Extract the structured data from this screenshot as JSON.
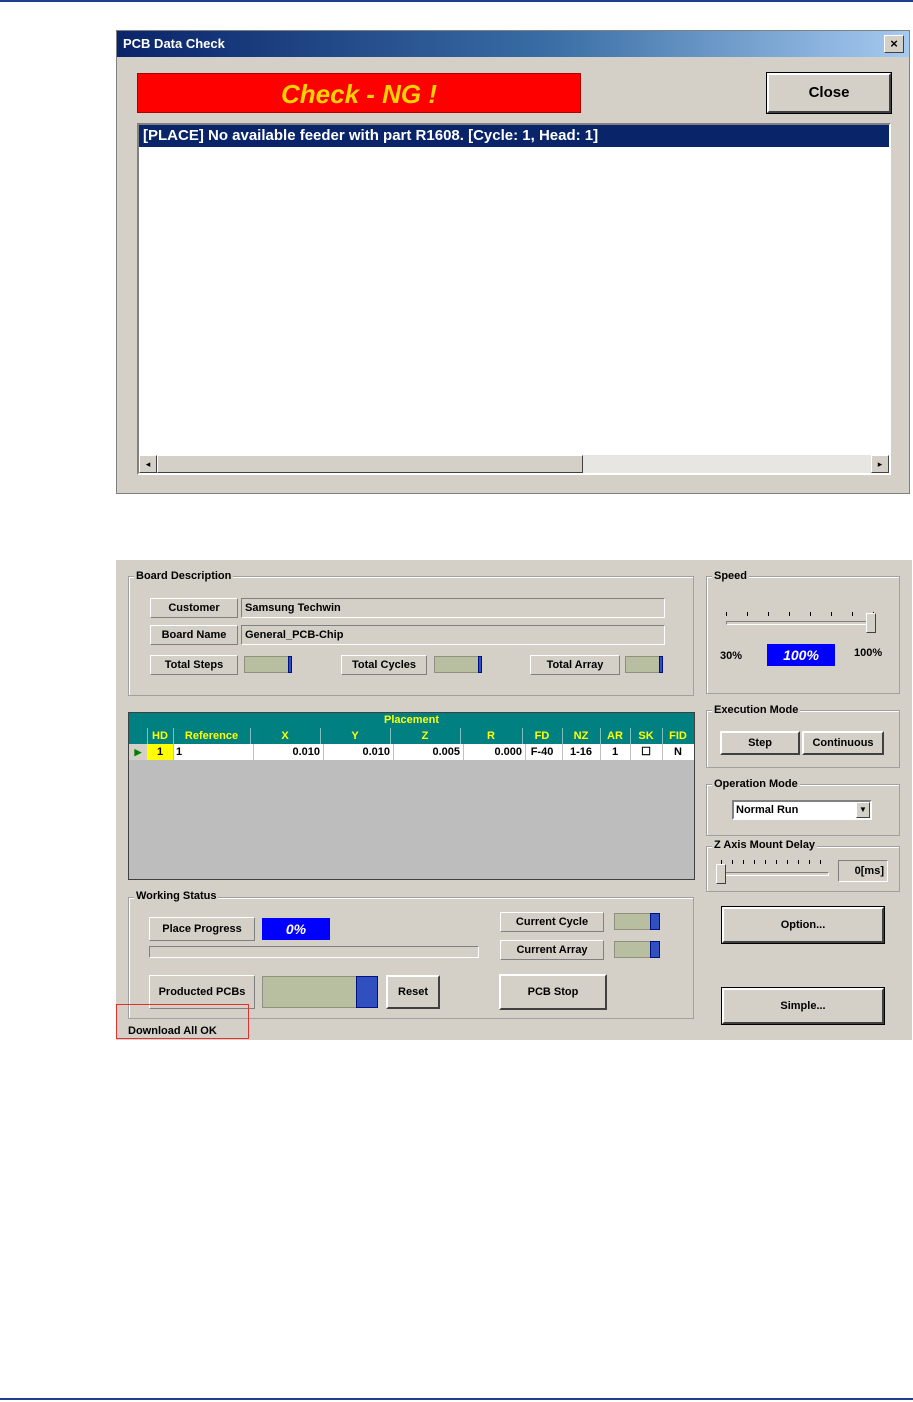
{
  "dialog": {
    "title": "PCB Data Check",
    "close_x": "×",
    "banner": "Check - NG !",
    "close_button": "Close",
    "message": "[PLACE] No available feeder with part R1608. [Cycle: 1, Head: 1]",
    "scroll_left": "◂",
    "scroll_right": "▸"
  },
  "board": {
    "group_label": "Board Description",
    "customer_label": "Customer",
    "customer_value": "Samsung Techwin",
    "board_name_label": "Board Name",
    "board_name_value": "General_PCB-Chip",
    "total_steps_label": "Total Steps",
    "total_cycles_label": "Total Cycles",
    "total_array_label": "Total Array"
  },
  "speed": {
    "group_label": "Speed",
    "min_label": "30%",
    "value": "100%",
    "max_label": "100%"
  },
  "execution_mode": {
    "group_label": "Execution Mode",
    "step": "Step",
    "continuous": "Continuous"
  },
  "operation_mode": {
    "group_label": "Operation Mode",
    "selected": "Normal Run",
    "arrow": "▼"
  },
  "z_axis": {
    "group_label": "Z Axis Mount Delay",
    "value": "0[ms]"
  },
  "placement": {
    "title": "Placement",
    "columns": [
      "HD",
      "Reference",
      "X",
      "Y",
      "Z",
      "R",
      "FD",
      "NZ",
      "AR",
      "SK",
      "FID"
    ],
    "row": {
      "indicator": "▶",
      "hd": "1",
      "reference": "1",
      "x": "0.010",
      "y": "0.010",
      "z": "0.005",
      "r": "0.000",
      "fd": "F-40",
      "nz": "1-16",
      "ar": "1",
      "sk": "☐",
      "fid": "N"
    }
  },
  "working_status": {
    "group_label": "Working Status",
    "place_progress_label": "Place Progress",
    "place_progress_value": "0%",
    "progress_fraction": 0,
    "current_cycle_label": "Current Cycle",
    "current_array_label": "Current Array",
    "producted_label": "Producted PCBs",
    "reset": "Reset",
    "pcb_stop": "PCB Stop"
  },
  "buttons": {
    "option": "Option...",
    "simple": "Simple..."
  },
  "status_bar": {
    "text": "Download All OK"
  },
  "colors": {
    "banner_bg": "#ff0000",
    "banner_text": "#ffd200",
    "grid_header": "#008080",
    "grid_header_text": "#ffff00",
    "speed_box": "#0000ff",
    "highlight_box": "#e03030"
  }
}
